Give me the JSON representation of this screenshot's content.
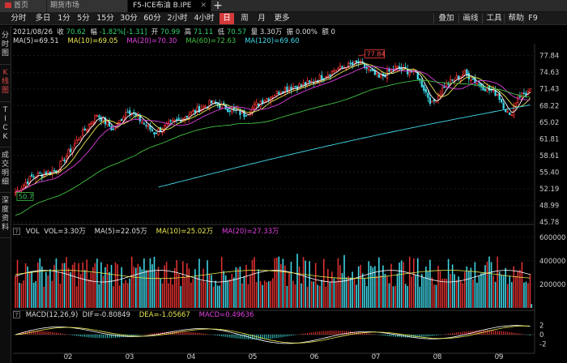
{
  "tabs": [
    {
      "label": "首页",
      "icon": "home-icon"
    },
    {
      "label": "期货市场"
    },
    {
      "label": "F5-ICE布油 B.IPE",
      "active": true
    }
  ],
  "toolbar": {
    "periods": [
      "分时",
      "多日",
      "1分",
      "5分",
      "15分",
      "30分",
      "60分",
      "2小时",
      "4小时",
      "日",
      "周",
      "月",
      "更多"
    ],
    "selected": "日",
    "right_buttons": [
      "叠加",
      "画线",
      "工具",
      "帮助",
      "F9"
    ]
  },
  "sidebar": {
    "items": [
      "分时图",
      "K线图",
      "TICK",
      "成交明细",
      "深度资料"
    ],
    "active": "K线图"
  },
  "info": {
    "date": "2021/08/26",
    "close_label": "收",
    "close": "70.62",
    "change_label": "幅",
    "change": "-1.82%[-1.31]",
    "open_label": "开",
    "open": "70.99",
    "high_label": "高",
    "high": "71.11",
    "low_label": "低",
    "low": "70.57",
    "volume_label": "量",
    "volume": "3.30万",
    "amp_label": "振",
    "amp": "0.00%",
    "amount_label": "额",
    "amount": "0"
  },
  "ma": {
    "ma5": "MA(5)=69.51",
    "ma10": "MA(10)=69.05",
    "ma20": "MA(20)=70.30",
    "ma60": "MA(60)=72.63",
    "ma120": "MA(120)=69.60"
  },
  "vol": {
    "label": "VOL",
    "vol": "VOL=3.30万",
    "ma5": "MA(5)=22.05万",
    "ma10": "MA(10)=25.02万",
    "ma20": "MA(20)=27.33万"
  },
  "macd": {
    "label": "MACD(12,26,9)",
    "dif": "DIF=-0.80849",
    "dea": "DEA=-1.05667",
    "macd": "MACD=0.49636"
  },
  "chart_data": {
    "type": "candlestick",
    "price_axis": [
      "77.84",
      "74.63",
      "71.43",
      "68.22",
      "65.02",
      "61.81",
      "58.61",
      "55.40",
      "52.19",
      "48.99",
      "45.78"
    ],
    "price_range": [
      45.78,
      79.5
    ],
    "high_marker": "77.84",
    "low_marker": "50.7",
    "vol_axis": [
      "600000",
      "400000",
      "200000"
    ],
    "vol_range": [
      0,
      620000
    ],
    "macd_axis": [
      "2",
      "0",
      "-2"
    ],
    "macd_range": [
      -3,
      3
    ],
    "x_labels": [
      "02",
      "03",
      "04",
      "05",
      "06",
      "07",
      "08",
      "09"
    ],
    "colors": {
      "up": "#ff3333",
      "down": "#40d8e8",
      "ma5": "#ffffff",
      "ma10": "#e8e850",
      "ma20": "#e040e0",
      "ma60": "#40c040",
      "ma120": "#40d8e8"
    }
  }
}
